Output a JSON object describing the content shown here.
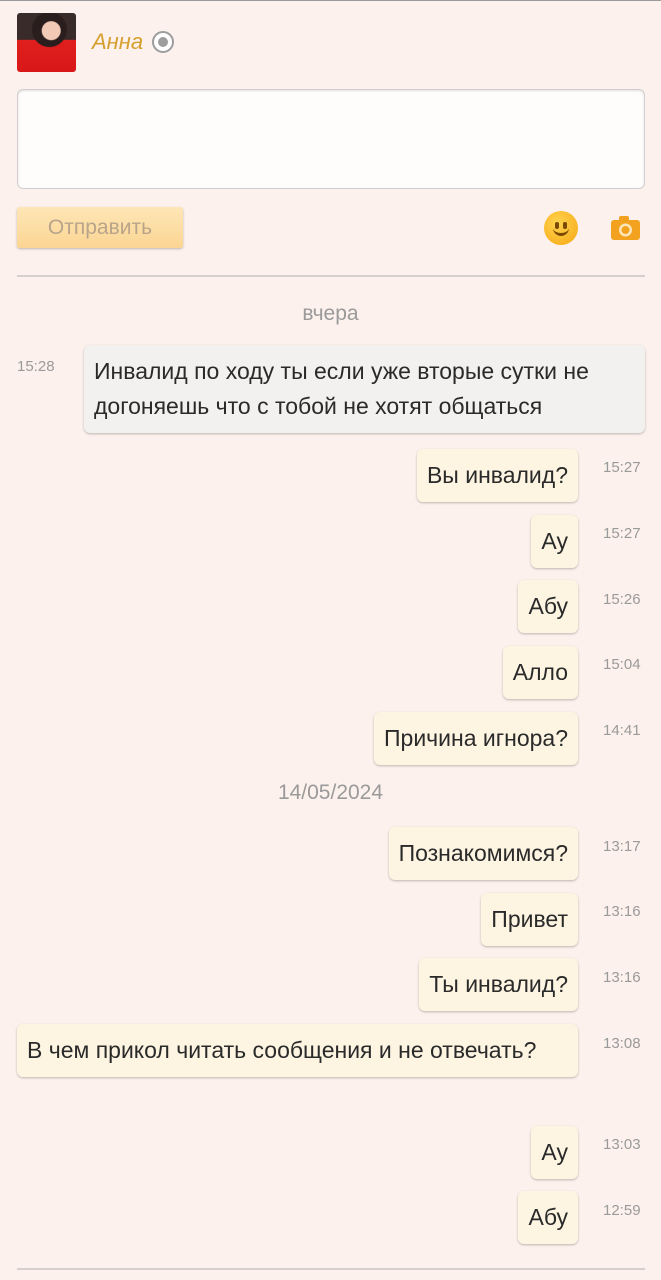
{
  "header": {
    "contact_name": "Анна"
  },
  "composer": {
    "send_label": "Отправить",
    "value": "",
    "placeholder": ""
  },
  "colors": {
    "accent": "#d5a02f",
    "background": "#fcf1ec",
    "outgoing": "#fdf5e2",
    "incoming": "#f2f1ef"
  },
  "dates": {
    "yesterday": "вчера",
    "older": "14/05/2024"
  },
  "messages": [
    {
      "time": "15:28",
      "text": "Инвалид по ходу ты если уже вторые сутки не догоняешь что с тобой не хотят общаться"
    },
    {
      "time": "15:27",
      "text": "Вы инвалид?"
    },
    {
      "time": "15:27",
      "text": "Ау"
    },
    {
      "time": "15:26",
      "text": "Абу"
    },
    {
      "time": "15:04",
      "text": "Алло"
    },
    {
      "time": "14:41",
      "text": "Причина игнора?"
    },
    {
      "time": "13:17",
      "text": "Познакомимся?"
    },
    {
      "time": "13:16",
      "text": "Привет"
    },
    {
      "time": "13:16",
      "text": "Ты инвалид?"
    },
    {
      "time": "13:08",
      "text": "В чем прикол читать сообщения и не отвечать?"
    },
    {
      "time": "13:03",
      "text": "Ау"
    },
    {
      "time": "12:59",
      "text": "Абу"
    }
  ]
}
